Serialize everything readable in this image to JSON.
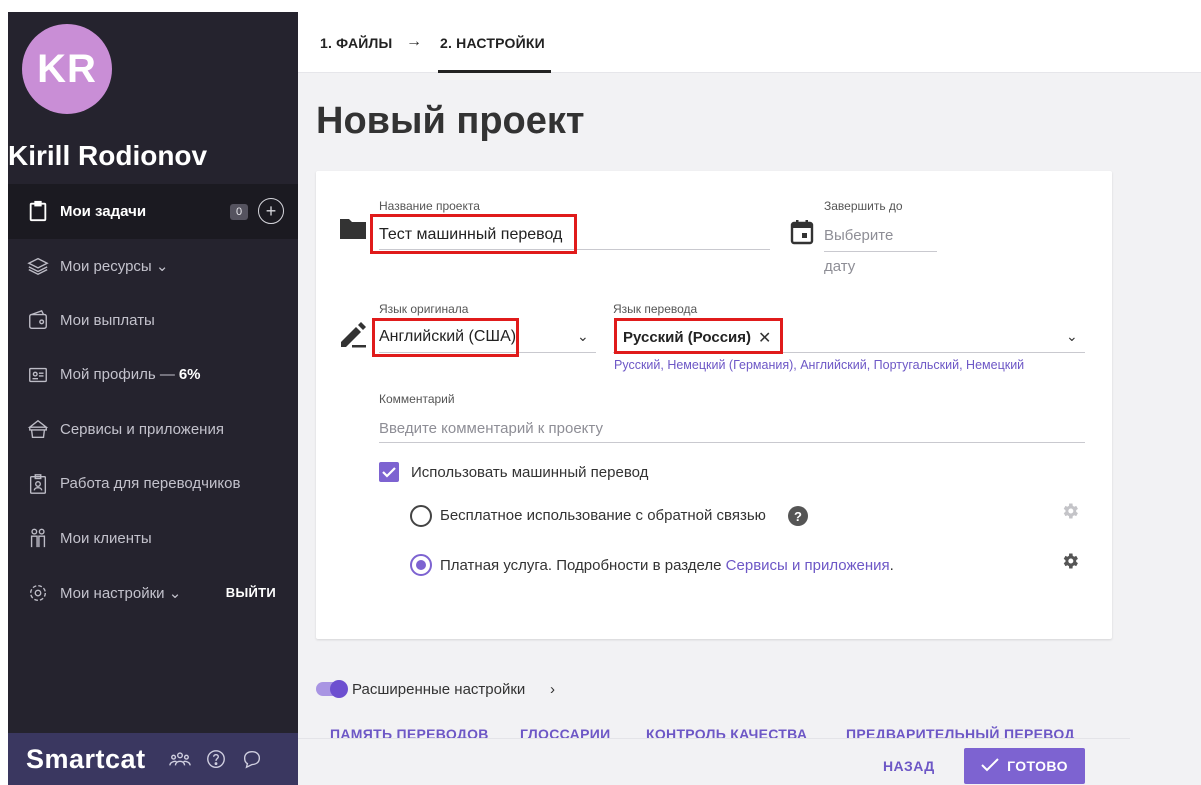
{
  "user": {
    "initials": "KR",
    "name": "Kirill Rodionov"
  },
  "sidebar": {
    "items": [
      {
        "label": "Мои задачи",
        "badge": "0"
      },
      {
        "label": "Мои ресурсы ⌄"
      },
      {
        "label": "Мои выплаты"
      },
      {
        "label": "Мой профиль —",
        "pct": "6%"
      },
      {
        "label": "Сервисы и приложения"
      },
      {
        "label": "Работа для переводчиков"
      },
      {
        "label": "Мои клиенты"
      },
      {
        "label": "Мои настройки ⌄",
        "action": "ВЫЙТИ"
      }
    ],
    "brand": "Smartcat"
  },
  "steps": {
    "step1": "1. ФАЙЛЫ",
    "arrow": "→",
    "step2": "2. НАСТРОЙКИ"
  },
  "page": {
    "title": "Новый проект"
  },
  "form": {
    "project_name": {
      "label": "Название проекта",
      "value": "Тест машинный перевод"
    },
    "deadline": {
      "label": "Завершить до",
      "placeholder_line1": "Выберите",
      "placeholder_line2": "дату"
    },
    "source_lang": {
      "label": "Язык оригинала",
      "value": "Английский (США)"
    },
    "target_lang": {
      "label": "Язык перевода",
      "chip": "Русский (Россия)",
      "suggestions": "Русский, Немецкий (Германия), Английский, Португальский, Немецкий"
    },
    "comment": {
      "label": "Комментарий",
      "placeholder": "Введите комментарий к проекту"
    },
    "mt_checkbox": "Использовать машинный перевод",
    "option_free": "Бесплатное использование с обратной связью",
    "option_paid_prefix": "Платная услуга. Подробности в разделе ",
    "option_paid_link": "Сервисы и приложения",
    "option_paid_suffix": "."
  },
  "advanced": {
    "label": "Расширенные настройки",
    "chevron": "›"
  },
  "tabs": [
    "ПАМЯТЬ ПЕРЕВОДОВ",
    "ГЛОССАРИИ",
    "КОНТРОЛЬ КАЧЕСТВА",
    "ПРЕДВАРИТЕЛЬНЫЙ ПЕРЕВОД"
  ],
  "actions": {
    "back": "НАЗАД",
    "done": "ГОТОВО"
  },
  "colors": {
    "accent": "#7d63d1",
    "sidebar": "#25232e",
    "highlight": "#e01b1b"
  }
}
